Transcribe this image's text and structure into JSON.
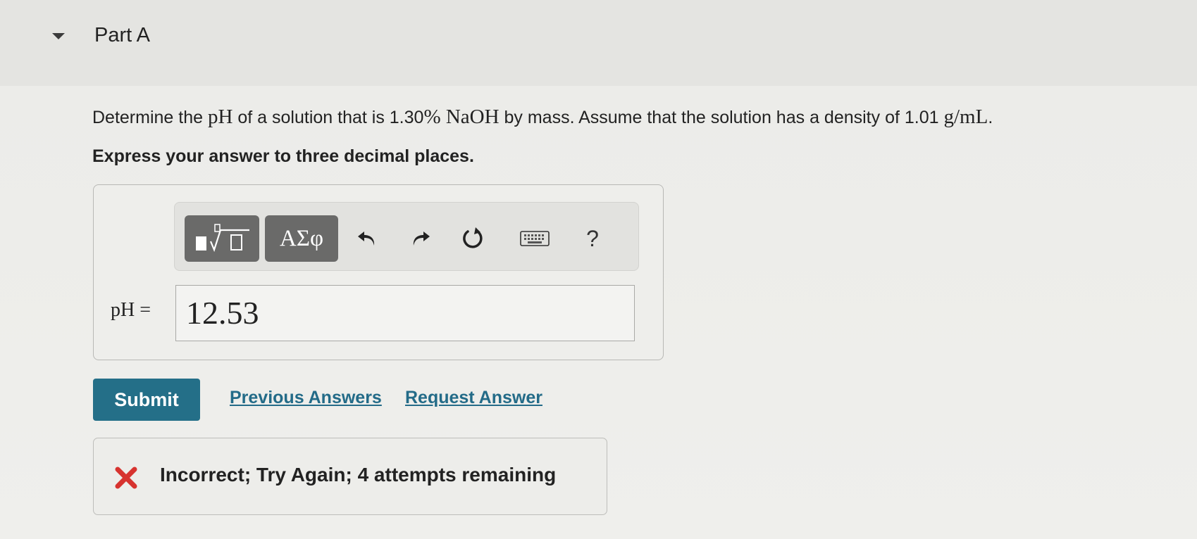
{
  "part": {
    "title": "Part A",
    "toggle_icon": "caret-down-icon"
  },
  "question": {
    "prefix": "Determine the ",
    "ph_symbol": "pH",
    "middle": " of a solution that is 1.30",
    "percent": "%",
    "naoh": " NaOH",
    "after_naoh": " by mass. Assume that the solution has a density of 1.01 ",
    "units": "g/mL",
    "end": ".",
    "instruction": "Express your answer to three decimal places."
  },
  "toolbar": {
    "templates_icon": "templates-icon",
    "symbols_label": "ΑΣφ",
    "undo_icon": "undo-icon",
    "redo_icon": "redo-icon",
    "reset_icon": "reset-icon",
    "keyboard_icon": "keyboard-icon",
    "help_label": "?"
  },
  "answer": {
    "label": "pH = ",
    "value": "12.53"
  },
  "actions": {
    "submit_label": "Submit",
    "previous_answers_label": "Previous Answers",
    "request_answer_label": "Request Answer"
  },
  "feedback": {
    "icon": "x-icon",
    "message": "Incorrect; Try Again; 4 attempts remaining"
  },
  "colors": {
    "accent": "#246f88",
    "link": "#236b88",
    "error": "#d7332f",
    "toolbar_button": "#6a6a69"
  }
}
